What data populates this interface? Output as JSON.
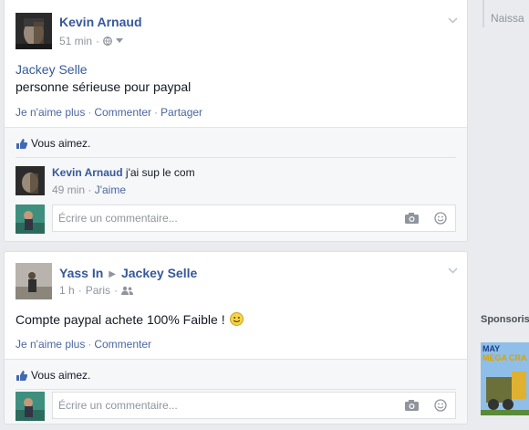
{
  "posts": [
    {
      "author": "Kevin Arnaud",
      "time": "51 min",
      "body_mention": "Jackey Selle",
      "body_text": "personne sérieuse pour paypal",
      "actions": [
        "Je n'aime plus",
        "Commenter",
        "Partager"
      ],
      "likes_text": "Vous aimez.",
      "comment": {
        "author": "Kevin Arnaud",
        "text": "j'ai sup le com",
        "time": "49 min",
        "like_label": "J'aime"
      },
      "write_placeholder": "Écrire un commentaire..."
    },
    {
      "author": "Yass In",
      "target": "Jackey Selle",
      "time": "1 h",
      "location": "Paris",
      "body_text": "Compte paypal achete 100% Faible !",
      "actions": [
        "Je n'aime plus",
        "Commenter"
      ],
      "likes_text": "Vous aimez.",
      "write_placeholder": "Écrire un commentaire..."
    }
  ],
  "right_column": {
    "birthdays_label": "Naissa",
    "sponsored_label": "Sponsoris",
    "ad_text_1": "MAY",
    "ad_text_2": "MEGA CRA"
  },
  "colors": {
    "link": "#365899",
    "background": "#e9ebee",
    "accent_like": "#4267b2"
  }
}
